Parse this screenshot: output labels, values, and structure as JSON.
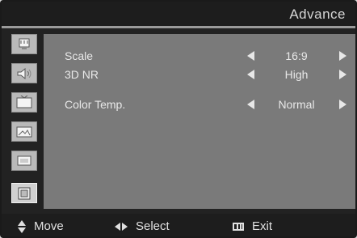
{
  "header": {
    "title": "Advance"
  },
  "sidebar": {
    "items": [
      {
        "icon": "ethernet-icon"
      },
      {
        "icon": "speaker-icon"
      },
      {
        "icon": "tv-icon"
      },
      {
        "icon": "picture-icon"
      },
      {
        "icon": "screen-icon"
      },
      {
        "icon": "advance-icon",
        "active": true
      }
    ]
  },
  "settings": [
    {
      "label": "Scale",
      "value": "16:9"
    },
    {
      "label": "3D NR",
      "value": "High"
    },
    {
      "label": "Color Temp.",
      "value": "Normal"
    }
  ],
  "footer": {
    "move_label": "Move",
    "select_label": "Select",
    "exit_label": "Exit"
  },
  "colors": {
    "panel": "#7a7a7a",
    "header": "#1d1d1d",
    "text": "#e8e8e8"
  }
}
